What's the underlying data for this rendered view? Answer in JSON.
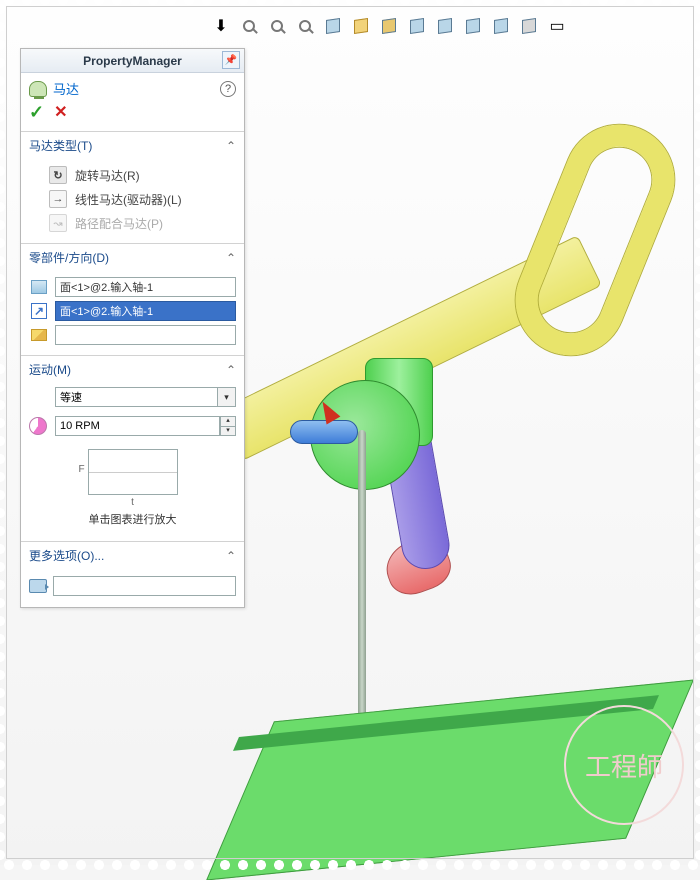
{
  "toolbar": {
    "icons": [
      "orient-icon",
      "zoom-fit-icon",
      "zoom-area-icon",
      "zoom-prev-icon",
      "section-icon",
      "view-orient-icon",
      "draft-analysis-icon",
      "display-shaded-icon",
      "display-hidden-icon",
      "display-wire-icon",
      "scene-icon",
      "perspective-icon",
      "screen-icon"
    ]
  },
  "panel": {
    "header": "PropertyManager",
    "title": "马达",
    "ok": "✓",
    "cancel": "✕",
    "help": "?",
    "sections": {
      "type": {
        "label": "马达类型(T)",
        "options": [
          {
            "label": "旋转马达(R)",
            "kind": "rot"
          },
          {
            "label": "线性马达(驱动器)(L)",
            "kind": "arrow"
          },
          {
            "label": "路径配合马达(P)",
            "kind": "path",
            "disabled": true
          }
        ]
      },
      "component": {
        "label": "零部件/方向(D)",
        "face_value": "面<1>@2.输入轴-1",
        "dir_value": "面<1>@2.输入轴-1",
        "relative_value": ""
      },
      "motion": {
        "label": "运动(M)",
        "mode": "等速",
        "speed": "10 RPM",
        "graph_axis_x": "t",
        "graph_axis_y": "F",
        "graph_hint": "单击图表进行放大"
      },
      "more": {
        "label": "更多选项(O)...",
        "value": ""
      }
    }
  },
  "watermark": "工程師"
}
